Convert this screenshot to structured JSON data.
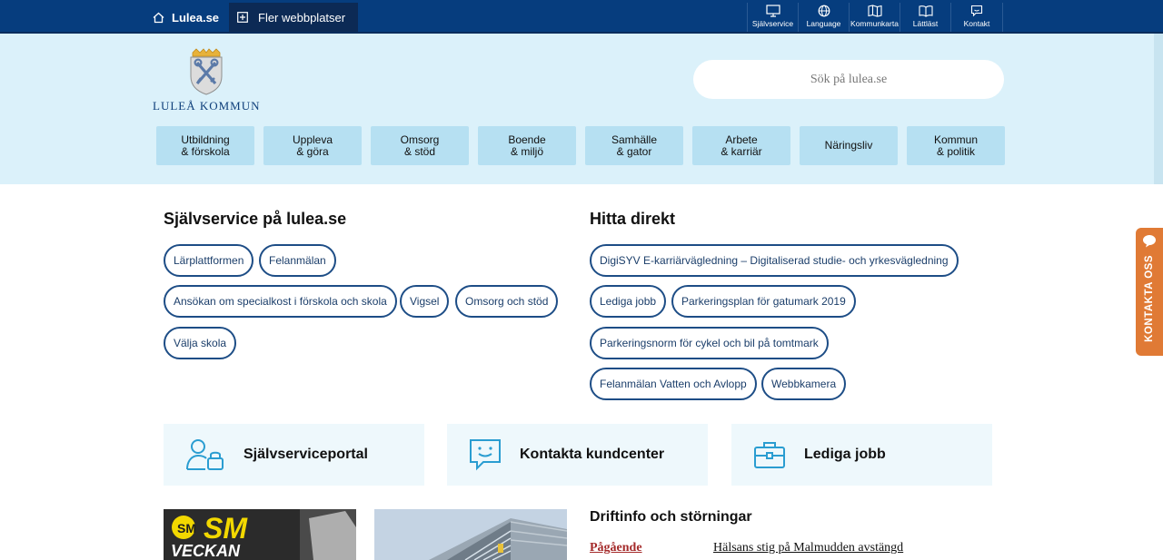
{
  "topbar": {
    "home_label": "Lulea.se",
    "more_sites_label": "Fler webbplatser",
    "tools": [
      {
        "label": "Självservice",
        "icon": "monitor-icon"
      },
      {
        "label": "Language",
        "icon": "globe-icon"
      },
      {
        "label": "Kommunkarta",
        "icon": "map-icon"
      },
      {
        "label": "Lättläst",
        "icon": "book-icon"
      },
      {
        "label": "Kontakt",
        "icon": "chat-icon"
      }
    ]
  },
  "header": {
    "logo_text": "LULEÅ KOMMUN",
    "search_placeholder": "Sök på lulea.se",
    "nav": [
      "Utbildning\n& förskola",
      "Uppleva\n& göra",
      "Omsorg\n& stöd",
      "Boende\n& miljö",
      "Samhälle\n& gator",
      "Arbete\n& karriär",
      "Näringsliv",
      "Kommun\n& politik"
    ]
  },
  "selfservice": {
    "title": "Självservice på lulea.se",
    "links": [
      "Lärplattformen",
      "Felanmälan",
      "Ansökan om specialkost i förskola och skola",
      "Vigsel",
      "Omsorg och stöd",
      "Välja skola"
    ]
  },
  "direct": {
    "title": "Hitta direkt",
    "links": [
      "DigiSYV E-karriärvägledning – Digitaliserad studie- och yrkesvägledning",
      "Lediga jobb",
      "Parkeringsplan för gatumark 2019",
      "Parkeringsnorm för cykel och bil på tomtmark",
      "Felanmälan Vatten och Avlopp",
      "Webbkamera"
    ]
  },
  "cards": [
    {
      "label": "Självserviceportal",
      "icon": "user-lock-icon"
    },
    {
      "label": "Kontakta kundcenter",
      "icon": "smile-chat-icon"
    },
    {
      "label": "Lediga jobb",
      "icon": "briefcase-icon"
    }
  ],
  "contact_tab": "KONTAKTA OSS",
  "news": {
    "image1_text": "SM VECKAN"
  },
  "drift": {
    "title": "Driftinfo och störningar",
    "status": "Pågående",
    "link": "Hälsans stig på Malmudden avstängd"
  },
  "colors": {
    "topbar": "#063d7e",
    "header_bg": "#dbf1fa",
    "nav_bg": "#b6e0f2",
    "pill_border": "#1d4d86",
    "contact_tab": "#e07a35",
    "icon_accent": "#2a9dd1"
  }
}
